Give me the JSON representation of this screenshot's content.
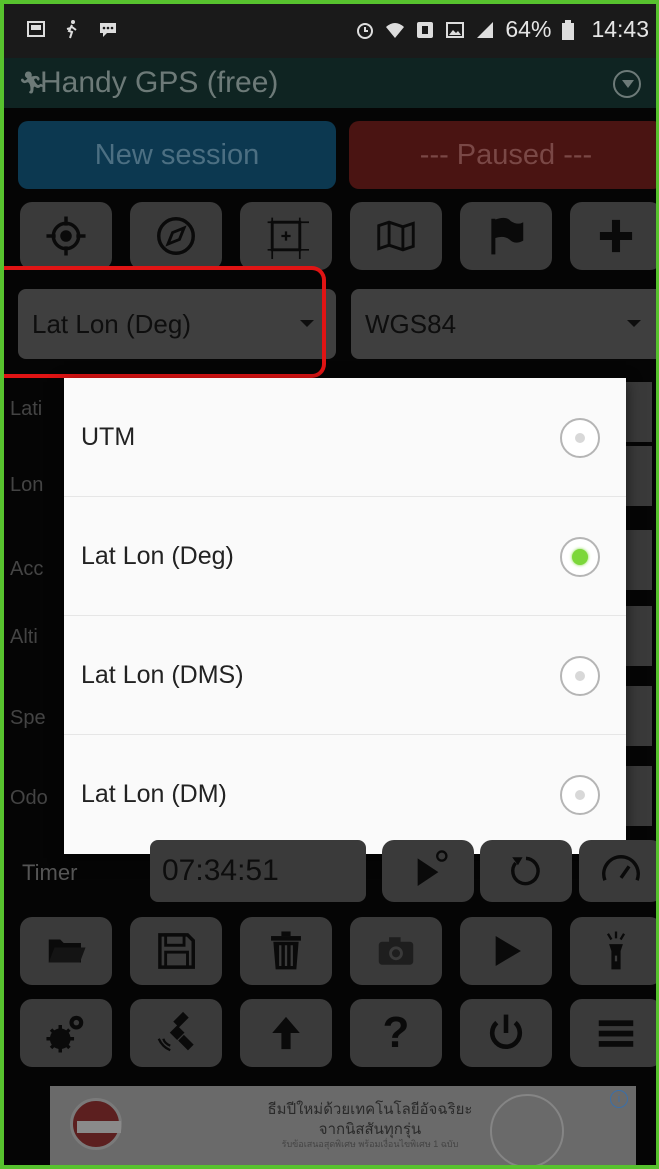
{
  "status_bar": {
    "battery": "64%",
    "time": "14:43"
  },
  "app": {
    "title": "Handy GPS (free)"
  },
  "session": {
    "new_label": "New session",
    "paused_label": "--- Paused ---"
  },
  "selects": {
    "format_value": "Lat Lon (Deg)",
    "datum_value": "WGS84"
  },
  "background_rows": [
    "Lati",
    "Lon",
    "Acc",
    "Alti",
    "Spe",
    "Odo"
  ],
  "popup": {
    "options": [
      {
        "label": "UTM",
        "selected": false
      },
      {
        "label": "Lat Lon (Deg)",
        "selected": true
      },
      {
        "label": "Lat Lon (DMS)",
        "selected": false
      },
      {
        "label": "Lat Lon (DM)",
        "selected": false
      }
    ]
  },
  "timer": {
    "label": "Timer",
    "value": "07:34:51"
  },
  "toolbar_icons": {
    "row1": [
      "target-icon",
      "compass-icon",
      "area-icon",
      "map-icon",
      "flag-icon",
      "plus-icon"
    ],
    "row3": [
      "folder-icon",
      "save-icon",
      "trash-icon",
      "camera-icon",
      "play-icon",
      "flashlight-icon"
    ],
    "row4": [
      "settings-icon",
      "satellite-icon",
      "arrow-up-icon",
      "help-icon",
      "power-icon",
      "menu-icon"
    ],
    "timer_row": [
      "play-timer-icon",
      "reset-icon",
      "speedometer-icon"
    ],
    "question_mark": "?"
  },
  "ad": {
    "line1": "ธีมปีใหม่ด้วยเทคโนโลยีอัจฉริยะ",
    "line2": "จากนิสสันทุกรุ่น",
    "line3": "รับข้อเสนอสุดพิเศษ พร้อมเงื่อนไขพิเศษ 1 ฉบับ"
  },
  "colors": {
    "accent_green": "#7cd73a",
    "highlight_red": "#e01414",
    "new_session_blue": "#0c3850",
    "paused_red": "#4a1412"
  }
}
